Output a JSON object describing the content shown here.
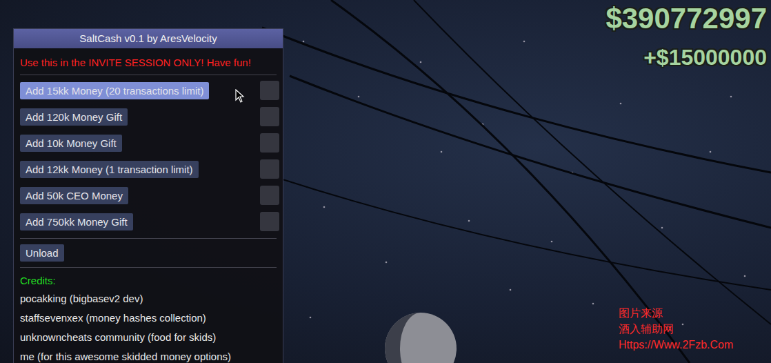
{
  "hud": {
    "money": "$390772997",
    "delta": "+$15000000"
  },
  "menu": {
    "title": "SaltCash v0.1 by AresVelocity",
    "warning": "Use this in the INVITE SESSION ONLY! Have fun!",
    "buttons": [
      {
        "label": "Add 15kk Money (20 transactions limit)",
        "hovered": true,
        "checked": false
      },
      {
        "label": "Add 120k Money Gift",
        "hovered": false,
        "checked": false
      },
      {
        "label": "Add 10k Money Gift",
        "hovered": false,
        "checked": false
      },
      {
        "label": "Add 12kk Money (1 transaction limit)",
        "hovered": false,
        "checked": false
      },
      {
        "label": "Add 50k CEO Money",
        "hovered": false,
        "checked": false
      },
      {
        "label": "Add 750kk Money Gift",
        "hovered": false,
        "checked": false
      }
    ],
    "unload": "Unload",
    "credits_title": "Credits:",
    "credits": [
      "pocakking (bigbasev2 dev)",
      "staffsevenxex (money hashes collection)",
      "unknowncheats community (food for skids)",
      "me (for this awesome skidded money options)"
    ]
  },
  "watermark": [
    "图片来源",
    "酒入辅助网",
    "Https://Www.2Fzb.Com"
  ]
}
